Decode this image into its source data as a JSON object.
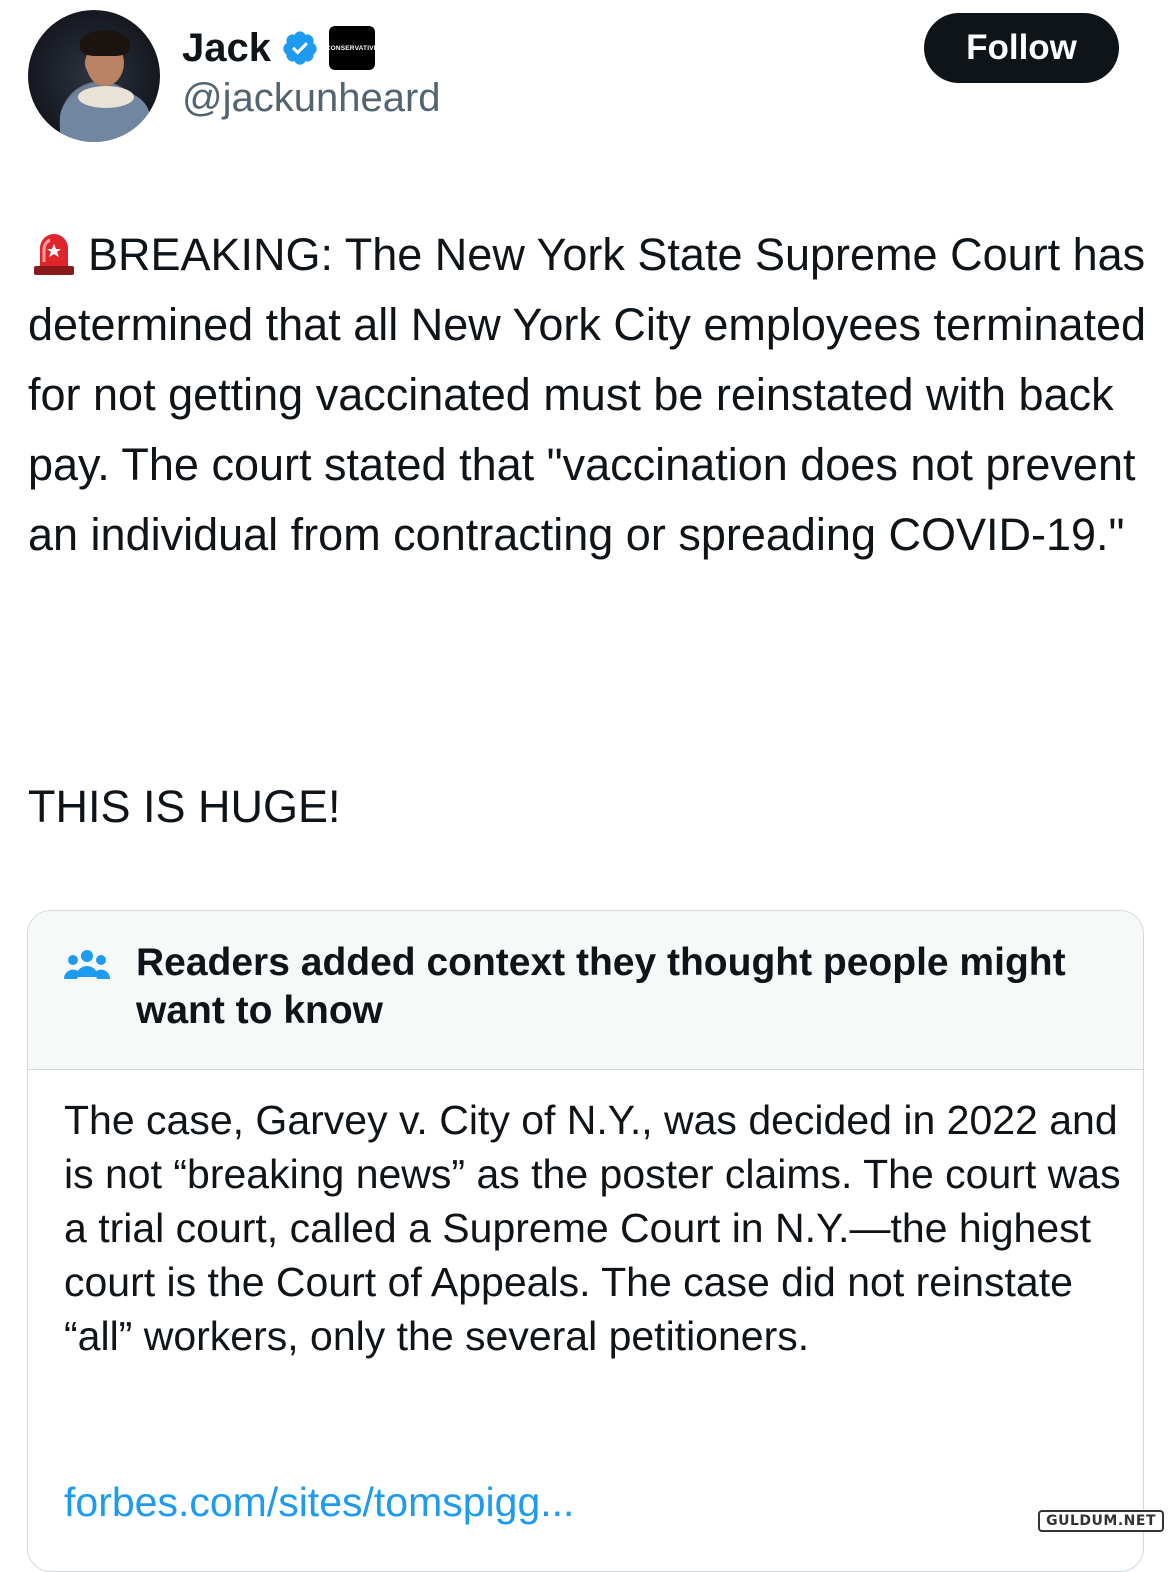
{
  "author": {
    "display_name": "Jack",
    "handle": "@jackunheard",
    "affiliate_badge": "CONSERVATIVE",
    "verified_icon": "verified-badge-icon"
  },
  "follow_label": "Follow",
  "tweet": {
    "emoji": "rotating-light-siren",
    "body": "BREAKING: The New York State Supreme Court has determined that all New York City employees terminated for not getting vaccinated must be reinstated with back pay. The court stated that \"vaccination does not prevent an individual from contracting or spreading COVID-19.\"",
    "tagline": "THIS IS HUGE!"
  },
  "community_note": {
    "title": "Readers added context they thought people might want to know",
    "body": "The case, Garvey v. City of N.Y., was decided in 2022 and is not “breaking news” as the poster claims. The court was a trial court, called a Supreme Court in N.Y.—the highest court is the Court of Appeals. The case did not reinstate “all” workers, only the several petitioners.",
    "link": "forbes.com/sites/tomspigg..."
  },
  "watermark": "GULDUM.NET",
  "colors": {
    "text": "#0f1419",
    "secondary": "#536471",
    "link": "#1d9bf0",
    "verified": "#1d9bf0",
    "note_header_bg": "#f7f9f9"
  }
}
